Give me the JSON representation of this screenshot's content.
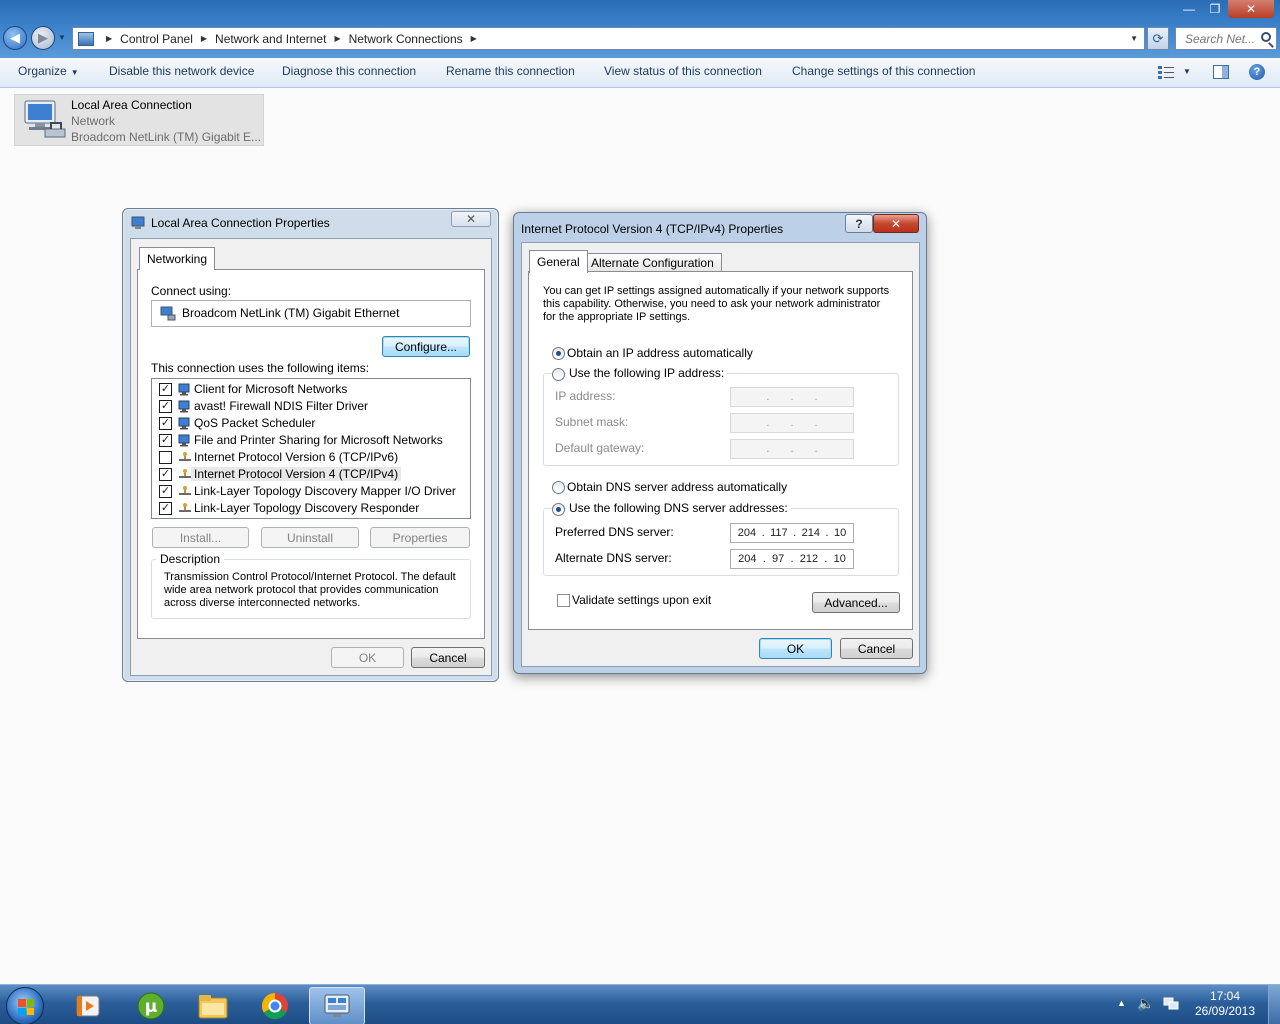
{
  "window": {
    "minimize_glyph": "—",
    "restore_glyph": "❐",
    "close_glyph": "✕"
  },
  "address": {
    "crumbs": [
      "Control Panel",
      "Network and Internet",
      "Network Connections"
    ],
    "search_placeholder": "Search Net..."
  },
  "toolbar": {
    "organize": "Organize",
    "disable": "Disable this network device",
    "diagnose": "Diagnose this connection",
    "rename": "Rename this connection",
    "view_status": "View status of this connection",
    "change_settings": "Change settings of this connection"
  },
  "connection": {
    "name": "Local Area Connection",
    "network": "Network",
    "adapter": "Broadcom NetLink (TM) Gigabit E..."
  },
  "lac_dialog": {
    "title": "Local Area Connection Properties",
    "tab": "Networking",
    "connect_using_label": "Connect using:",
    "adapter": "Broadcom NetLink (TM) Gigabit Ethernet",
    "configure": "Configure...",
    "items_label": "This connection uses the following items:",
    "items": [
      {
        "label": "Client for Microsoft Networks",
        "checked": true
      },
      {
        "label": "avast! Firewall NDIS Filter Driver",
        "checked": true
      },
      {
        "label": "QoS Packet Scheduler",
        "checked": true
      },
      {
        "label": "File and Printer Sharing for Microsoft Networks",
        "checked": true
      },
      {
        "label": "Internet Protocol Version 6 (TCP/IPv6)",
        "checked": false
      },
      {
        "label": "Internet Protocol Version 4 (TCP/IPv4)",
        "checked": true
      },
      {
        "label": "Link-Layer Topology Discovery Mapper I/O Driver",
        "checked": true
      },
      {
        "label": "Link-Layer Topology Discovery Responder",
        "checked": true
      }
    ],
    "install": "Install...",
    "uninstall": "Uninstall",
    "properties": "Properties",
    "description_label": "Description",
    "description": "Transmission Control Protocol/Internet Protocol. The default wide area network protocol that provides communication across diverse interconnected networks.",
    "ok": "OK",
    "cancel": "Cancel"
  },
  "ipv4_dialog": {
    "title": "Internet Protocol Version 4 (TCP/IPv4) Properties",
    "help_glyph": "?",
    "tab_general": "General",
    "tab_alternate": "Alternate Configuration",
    "intro": "You can get IP settings assigned automatically if your network supports this capability. Otherwise, you need to ask your network administrator for the appropriate IP settings.",
    "obtain_ip_auto": "Obtain an IP address automatically",
    "use_following_ip": "Use the following IP address:",
    "ip_address_label": "IP address:",
    "subnet_label": "Subnet mask:",
    "gateway_label": "Default gateway:",
    "obtain_dns_auto": "Obtain DNS server address automatically",
    "use_following_dns": "Use the following DNS server addresses:",
    "preferred_dns_label": "Preferred DNS server:",
    "preferred_dns": [
      "204",
      "117",
      "214",
      "10"
    ],
    "alternate_dns_label": "Alternate DNS server:",
    "alternate_dns": [
      "204",
      "97",
      "212",
      "10"
    ],
    "validate_label": "Validate settings upon exit",
    "advanced": "Advanced...",
    "ok": "OK",
    "cancel": "Cancel"
  },
  "taskbar": {
    "time": "17:04",
    "date": "26/09/2013"
  }
}
